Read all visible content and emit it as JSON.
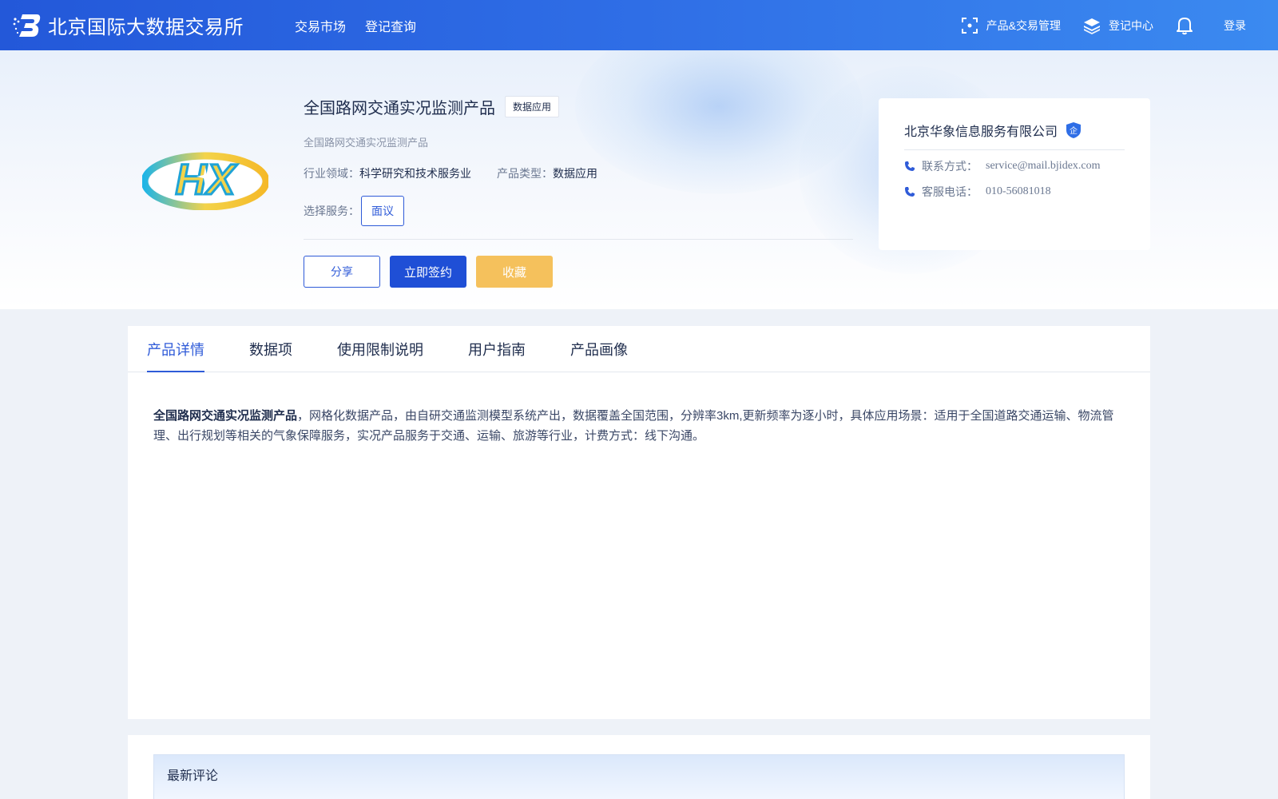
{
  "header": {
    "brand_name": "北京国际大数据交易所",
    "nav": [
      "交易市场",
      "登记查询"
    ],
    "right": {
      "product_trade": "产品&交易管理",
      "register_center": "登记中心",
      "login": "登录"
    }
  },
  "product": {
    "title": "全国路网交通实况监测产品",
    "tag": "数据应用",
    "subtitle": "全国路网交通实况监测产品",
    "industry_label": "行业领域：",
    "industry_value": "科学研究和技术服务业",
    "type_label": "产品类型：",
    "type_value": "数据应用",
    "service_label": "选择服务：",
    "service_option": "面议",
    "logo_text": "HX",
    "buttons": {
      "share": "分享",
      "sign": "立即签约",
      "favorite": "收藏"
    }
  },
  "company": {
    "name": "北京华象信息服务有限公司",
    "badge": "企",
    "contact_label": "联系方式：",
    "contact_value": "service@mail.bjidex.com",
    "phone_label": "客服电话：",
    "phone_value": "010-56081018"
  },
  "tabs": [
    "产品详情",
    "数据项",
    "使用限制说明",
    "用户指南",
    "产品画像"
  ],
  "active_tab": 0,
  "detail": {
    "bold_title": "全国路网交通实况监测产品",
    "text": "，网格化数据产品，由自研交通监测模型系统产出，数据覆盖全国范围，分辨率3km,更新频率为逐小时，具体应用场景：适用于全国道路交通运输、物流管理、出行规划等相关的气象保障服务，实况产品服务于交通、运输、旅游等行业，计费方式：线下沟通。"
  },
  "comments": {
    "title": "最新评论"
  },
  "colors": {
    "primary": "#1f4fd6",
    "accent_yellow": "#f5c15c",
    "nav_gradient_start": "#2358d9",
    "nav_gradient_end": "#3b8af0"
  }
}
